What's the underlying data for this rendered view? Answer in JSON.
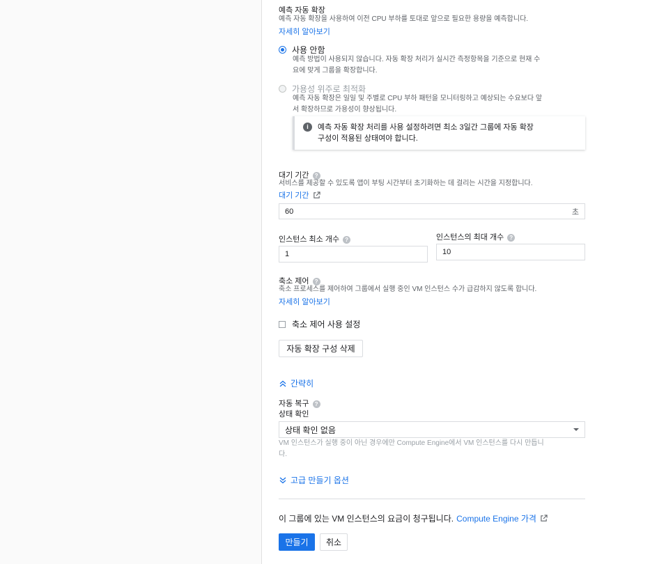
{
  "predictive": {
    "title": "예측 자동 확장",
    "desc": "예측 자동 확장을 사용하여 이전 CPU 부하를 토대로 앞으로 필요한 용량을 예측합니다.",
    "learn_more": "자세히 알아보기",
    "options": [
      {
        "label": "사용 안함",
        "desc_line1": "예측 방법이 사용되지 않습니다. 자동 확장 처리가 실시간 측정항목을 기준으로 현재 수",
        "desc_line2": "요에 맞게 그룹을 확장합니다.",
        "selected": true,
        "disabled": false
      },
      {
        "label": "가용성 위주로 최적화",
        "desc_line1": "예측 자동 확장은 일일 및 주별로 CPU 부하 패턴을 모니터링하고 예상되는 수요보다 앞",
        "desc_line2": "서 확장하므로 가용성이 향상됩니다.",
        "selected": false,
        "disabled": true
      }
    ],
    "info_line1": "예측 자동 확장 처리를 사용 설정하려면 최소 3일간 그룹에 자동 확장",
    "info_line2": "구성이 적용된 상태여야 합니다."
  },
  "cooldown": {
    "title": "대기 기간",
    "desc": "서비스를 제공할 수 있도록 앱이 부팅 시간부터 초기화하는 데 걸리는 시간을 지정합니다.",
    "link": "대기 기간",
    "value": "60",
    "unit": "초"
  },
  "instances": {
    "min_label": "인스턴스 최소 개수",
    "min_value": "1",
    "max_label": "인스턴스의 최대 개수",
    "max_value": "10"
  },
  "scale_in": {
    "title": "축소 제어",
    "desc": "축소 프로세스를 제어하여 그룹에서 실행 중인 VM 인스턴스 수가 급감하지 않도록 합니다.",
    "learn_more": "자세히 알아보기",
    "checkbox_label": "축소 제어 사용 설정",
    "checked": false
  },
  "delete_autoscaling_button": "자동 확장 구성 삭제",
  "collapse_toggle": "간략히",
  "autohealing": {
    "title": "자동 복구",
    "health_check_label": "상태 확인",
    "health_check_value": "상태 확인 없음",
    "desc_line1": "VM 인스턴스가 실행 중이 아닌 경우에만 Compute Engine에서 VM 인스턴스를 다시 만듭니",
    "desc_line2": "다."
  },
  "advanced_toggle": "고급 만들기 옵션",
  "billing": {
    "text": "이 그룹에 있는 VM 인스턴스의 요금이 청구됩니다.",
    "link": "Compute Engine 가격"
  },
  "create_button": "만들기",
  "cancel_button": "취소",
  "colors": {
    "accent": "#1a73e8",
    "text": "#202124",
    "secondary_text": "#5f6368",
    "border": "#dadce0"
  },
  "icons": [
    "help-icon",
    "info-icon",
    "external-link-icon",
    "chevron-up-icon",
    "chevron-down-icon",
    "dropdown-caret-icon"
  ]
}
